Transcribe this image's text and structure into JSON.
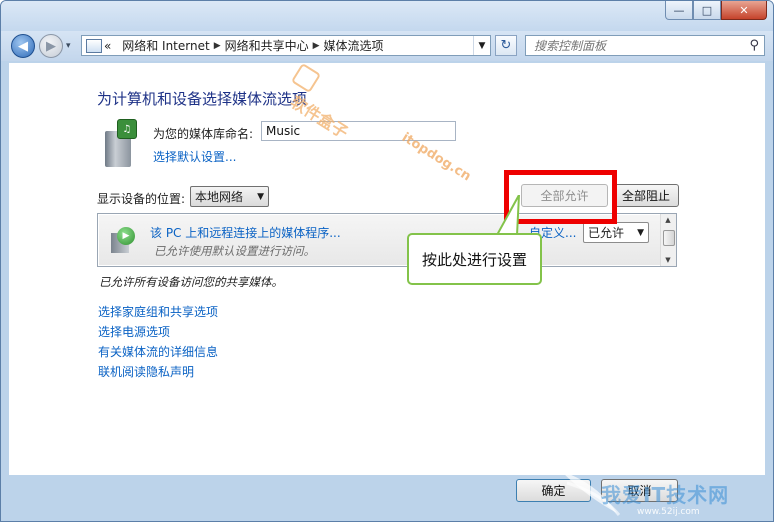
{
  "window": {
    "caption_buttons": {
      "minimize": "—",
      "maximize": "□",
      "close": "✕"
    }
  },
  "nav": {
    "history_dropdown": "▾",
    "breadcrumb": [
      "网络和 Internet",
      "网络和共享中心",
      "媒体流选项"
    ],
    "breadcrumb_prefix": "«",
    "refresh": "↻",
    "search_placeholder": "搜索控制面板",
    "icons": [
      "back-arrow-icon",
      "forward-arrow-icon",
      "control-panel-icon",
      "refresh-icon",
      "search-icon"
    ]
  },
  "main": {
    "heading": "为计算机和设备选择媒体流选项",
    "library_name_label": "为您的媒体库命名:",
    "library_name_value": "Music",
    "choose_default_link": "选择默认设置...",
    "show_devices_label": "显示设备的位置:",
    "location_selected": "本地网络",
    "allow_all_button": "全部允许",
    "block_all_button": "全部阻止",
    "device": {
      "name": "该 PC 上和远程连接上的媒体程序...",
      "description": "已允许使用默认设置进行访问。",
      "customize_link": "自定义...",
      "status_selected": "已允许"
    },
    "status_text": "已允许所有设备访问您的共享媒体。",
    "links": [
      "选择家庭组和共享选项",
      "选择电源选项",
      "有关媒体流的详细信息",
      "联机阅读隐私声明"
    ]
  },
  "annotation": {
    "callout_text": "按此处进行设置",
    "highlight_color": "#ee0000",
    "callout_border_color": "#83c34a"
  },
  "watermarks": {
    "top_text": "软件盒子",
    "top_url": "itopdog.cn",
    "bottom_text": "我爱IT技术网",
    "bottom_url": "www.52ij.com"
  },
  "footer": {
    "ok_button": "确定",
    "cancel_button": "取消"
  },
  "colors": {
    "link": "#0a62c4",
    "heading": "#1e3287",
    "window_frame": "#bcd3ea"
  }
}
